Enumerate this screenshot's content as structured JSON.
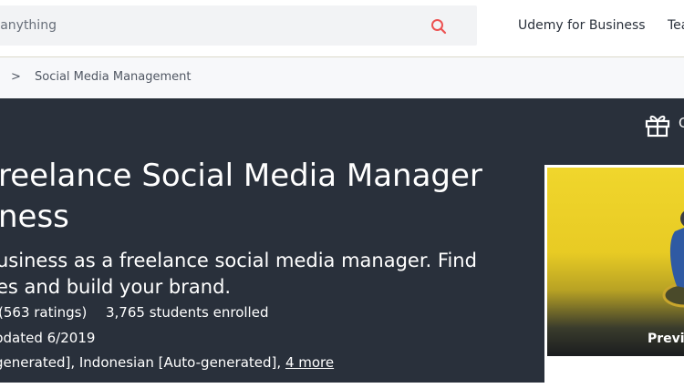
{
  "header": {
    "search_placeholder": "r anything",
    "nav_business": "Udemy for Business",
    "nav_teach": "Tea"
  },
  "breadcrumb": {
    "separator": ">",
    "current": "Social Media Management"
  },
  "hero": {
    "gift_text": "G",
    "title_line1": "reelance Social Media Manager",
    "title_line2": "ness",
    "subtitle_line1": "usiness as a freelance social media manager. Find",
    "subtitle_line2": "es and build your brand.",
    "ratings": "(563 ratings)",
    "students": "3,765 students enrolled",
    "updated": "pdated 6/2019",
    "languages": "generated], Indonesian [Auto-generated],",
    "more_link": "4 more"
  },
  "preview": {
    "label": "Previ"
  },
  "colors": {
    "hero_bg": "#29303b",
    "search_icon": "#ec5252",
    "header_bg": "#ffffff",
    "breadcrumb_bg": "#f7f8fa"
  }
}
